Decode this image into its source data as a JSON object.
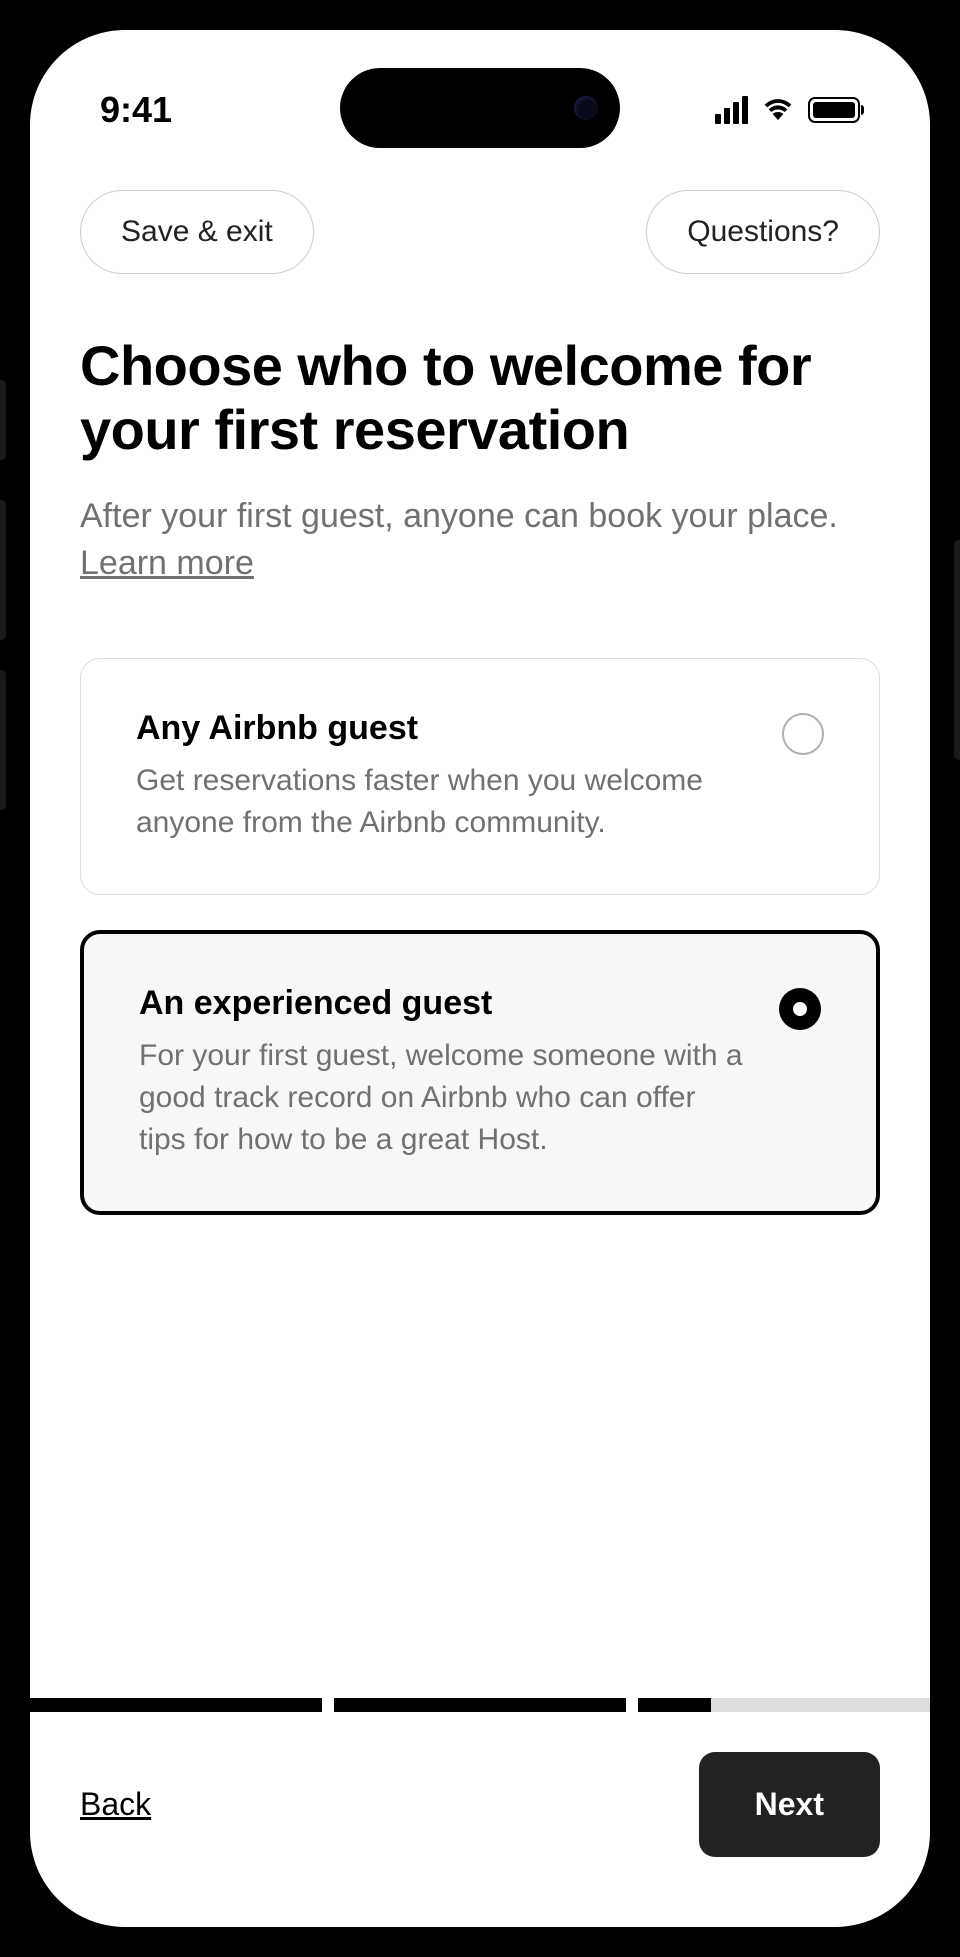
{
  "status": {
    "time": "9:41"
  },
  "topButtons": {
    "saveExit": "Save & exit",
    "questions": "Questions?"
  },
  "heading": "Choose who to welcome for your first reservation",
  "subtitle": {
    "text": "After your first guest, anyone can book your place. ",
    "learnMore": "Learn more"
  },
  "options": [
    {
      "title": "Any Airbnb guest",
      "desc": "Get reservations faster when you welcome anyone from the Airbnb community.",
      "selected": false
    },
    {
      "title": "An experienced guest",
      "desc": "For your first guest, welcome someone with a good track record on Airbnb who can offer tips for how to be a great Host.",
      "selected": true
    }
  ],
  "progress": {
    "segments": [
      100,
      100,
      25
    ]
  },
  "footer": {
    "back": "Back",
    "next": "Next"
  }
}
